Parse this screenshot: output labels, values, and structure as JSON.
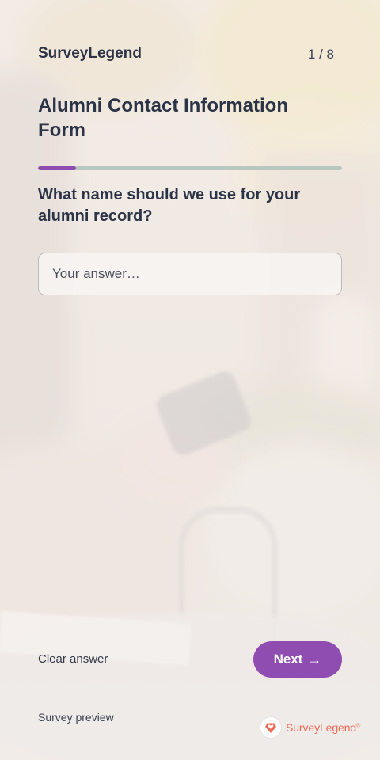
{
  "header": {
    "brand": "SurveyLegend",
    "page_indicator": "1 / 8"
  },
  "form": {
    "title": "Alumni Contact Information Form",
    "progress": 0.125,
    "question": "What name should we use for your alumni record?",
    "answer_value": "",
    "answer_placeholder": "Your answer…"
  },
  "footer": {
    "clear_label": "Clear answer",
    "next_label": "Next",
    "next_arrow": "→",
    "preview_label": "Survey preview",
    "logo_text": "SurveyLegend",
    "logo_reg": "®"
  },
  "colors": {
    "accent": "#8f4db1",
    "progress_track": "#b9c7c1",
    "text": "#2b3346",
    "logo": "#ee6a55"
  },
  "icons": {
    "next": "arrow-right-icon",
    "logo": "heart-diamond-logo-icon"
  }
}
